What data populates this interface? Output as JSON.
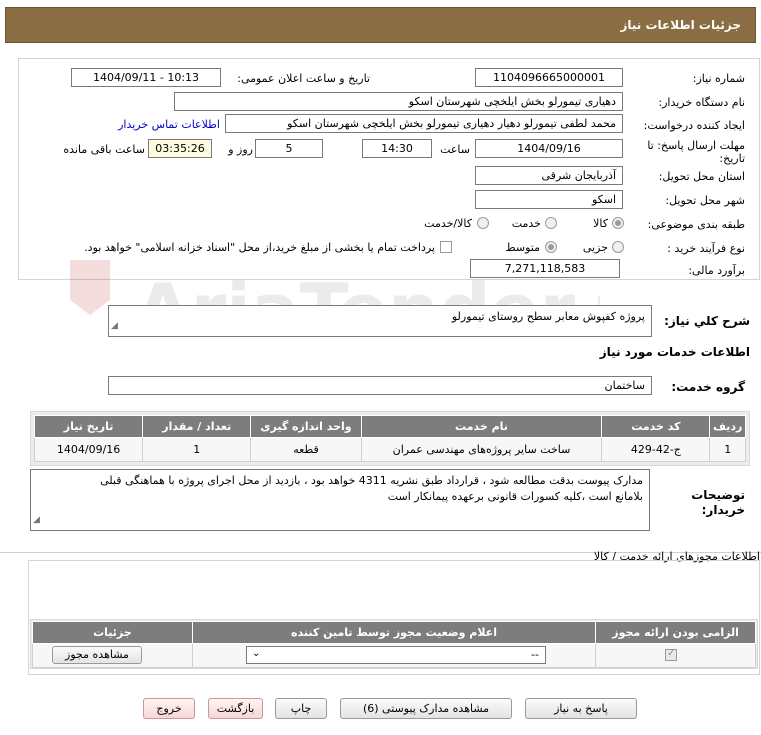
{
  "header": {
    "title": "جزئیات اطلاعات نیاز"
  },
  "form": {
    "need_number_label": "شماره نیاز:",
    "need_number": "1104096665000001",
    "announce_label": "تاریخ و ساعت اعلان عمومی:",
    "announce_value": "1404/09/11 - 10:13",
    "buyer_org_label": "نام دستگاه خریدار:",
    "buyer_org": "دهیاری تیمورلو بخش ایلخچی شهرستان اسکو",
    "creator_label": "ایجاد کننده درخواست:",
    "creator": "محمد لطفی تیمورلو  دهیار دهیاری تیمورلو بخش ایلخچی شهرستان اسکو",
    "contact_link": "اطلاعات تماس خریدار",
    "deadline_label_1": "مهلت ارسال پاسخ: تا",
    "deadline_label_2": "تاریخ:",
    "deadline_date": "1404/09/16",
    "time_label": "ساعت",
    "deadline_time": "14:30",
    "days_value": "5",
    "days_label": "روز و",
    "remaining_time": "03:35:26",
    "remaining_label": "ساعت باقی مانده",
    "province_label": "استان محل تحویل:",
    "province": "آذربایجان شرقی",
    "city_label": "شهر محل تحویل:",
    "city": "اسکو",
    "category_label": "طبقه بندی موضوعی:",
    "category_options": [
      "کالا",
      "خدمت",
      "کالا/خدمت"
    ],
    "process_label": "نوع فرآیند خرید :",
    "process_options": [
      "جزیی",
      "متوسط"
    ],
    "payment_note": "پرداخت تمام یا بخشی از مبلغ خرید،از محل \"اسناد خزانه اسلامی\" خواهد بود.",
    "estimate_label": "برآورد مالی:",
    "estimate": "7,271,118,583"
  },
  "summary": {
    "label": "شرح کلي نياز:",
    "text": "پروژه کفپوش معابر سطح روستای تیمورلو"
  },
  "services": {
    "section_title": "اطلاعات خدمات مورد نیاز",
    "group_label": "گروه خدمت:",
    "group_value": "ساختمان",
    "table": {
      "headers": [
        "ردیف",
        "کد خدمت",
        "نام خدمت",
        "واحد اندازه گیری",
        "تعداد / مقدار",
        "تاریخ نیاز"
      ],
      "rows": [
        [
          "1",
          "ج-42-429",
          "ساخت سایر پروژه‌های مهندسی عمران",
          "قطعه",
          "1",
          "1404/09/16"
        ]
      ]
    }
  },
  "buyer_notes": {
    "label_1": "توضیحات",
    "label_2": "خریدار:",
    "line_1": "مدارک پیوست بدقت مطالعه شود ، قرارداد طبق نشریه 4311 خواهد بود ، بازدید از محل اجرای پروژه  با هماهنگی قبلی",
    "line_2": "بلامانع است ،کلیه کسورات قانونی برعهده پیمانکار است"
  },
  "permits": {
    "section_title": "اطلاعات مجوزهای ارائه خدمت / کالا",
    "headers": [
      "الزامی بودن ارائه مجوز",
      "اعلام وضعیت مجوز توسط تامین کننده",
      "جزئیات"
    ],
    "select_value": "--",
    "view_button": "مشاهده مجوز"
  },
  "buttons": {
    "reply": "پاسخ به نیاز",
    "attachments": "مشاهده مدارک پیوستی (6)",
    "print": "چاپ",
    "back": "بازگشت",
    "exit": "خروج"
  },
  "watermark_text": "AriaTender.neT",
  "colors": {
    "header": "#8a6d43",
    "table_header": "#7d7d7d",
    "link": "#0000d0"
  }
}
